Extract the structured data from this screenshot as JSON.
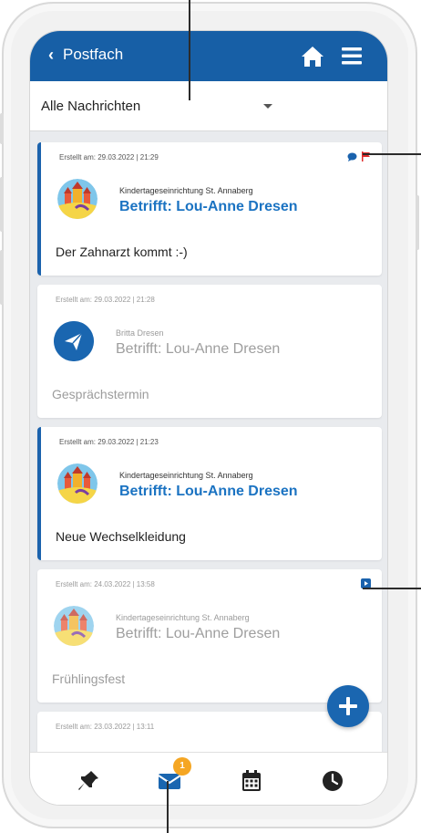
{
  "header": {
    "back_label": "Postfach",
    "icons": {
      "back": "chevron-left-icon",
      "home": "home-icon",
      "menu": "hamburger-menu-icon"
    }
  },
  "filter": {
    "selected": "Alle Nachrichten"
  },
  "messages": [
    {
      "date": "Erstellt am: 29.03.2022 | 21:29",
      "sender": "Kindertageseinrichtung St. Annaberg",
      "subject": "Betrifft: Lou-Anne Dresen",
      "preview": "Der Zahnarzt kommt :-)",
      "status": "unread",
      "avatar": "kita-castle-logo",
      "icons": [
        "comment-icon",
        "flag-icon"
      ]
    },
    {
      "date": "Erstellt am: 29.03.2022 | 21:28",
      "sender": "Britta Dresen",
      "subject": "Betrifft: Lou-Anne Dresen",
      "preview": "Gesprächstermin",
      "status": "read",
      "avatar": "paper-plane-icon",
      "icons": []
    },
    {
      "date": "Erstellt am: 29.03.2022 | 21:23",
      "sender": "Kindertageseinrichtung St. Annaberg",
      "subject": "Betrifft: Lou-Anne Dresen",
      "preview": "Neue Wechselkleidung",
      "status": "unread",
      "avatar": "kita-castle-logo",
      "icons": []
    },
    {
      "date": "Erstellt am: 24.03.2022 | 13:58",
      "sender": "Kindertageseinrichtung St. Annaberg",
      "subject": "Betrifft: Lou-Anne Dresen",
      "preview": "Frühlingsfest",
      "status": "read",
      "avatar": "kita-castle-logo",
      "icons": [
        "reply-icon"
      ]
    },
    {
      "date": "Erstellt am: 23.03.2022 | 13:11",
      "status": "read"
    }
  ],
  "bottom_nav": {
    "items": [
      "pin-icon",
      "mail-icon",
      "calendar-icon",
      "clock-icon"
    ],
    "mail_badge": "1"
  },
  "colors": {
    "primary": "#175fa6",
    "link": "#1b73c2",
    "flag": "#e02b2b",
    "badge": "#f5a623"
  }
}
